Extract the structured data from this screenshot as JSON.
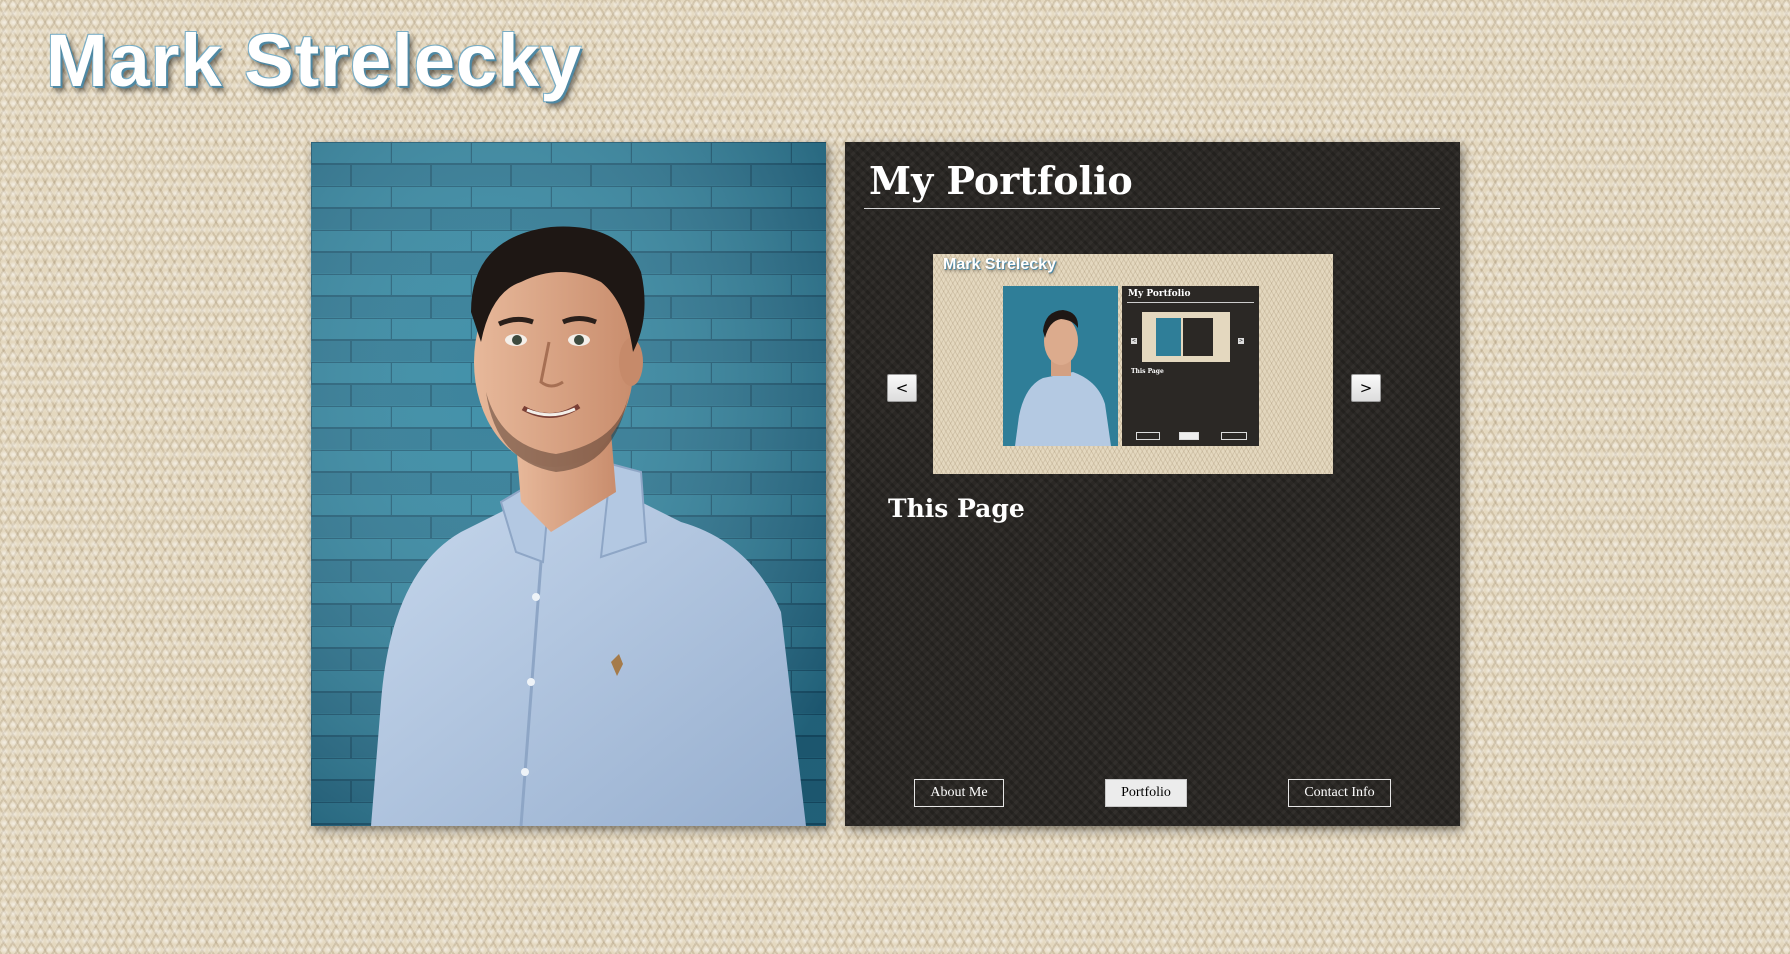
{
  "site": {
    "title": "Mark Strelecky"
  },
  "panel": {
    "heading": "My Portfolio",
    "prev_label": "<",
    "next_label": ">",
    "slide_caption": "This Page"
  },
  "preview": {
    "title": "Mark Strelecky",
    "heading": "My Portfolio",
    "caption": "This Page",
    "prev_label": "<",
    "next_label": ">"
  },
  "nav": {
    "about_label": "About Me",
    "portfolio_label": "Portfolio",
    "contact_label": "Contact Info",
    "active": "Portfolio"
  },
  "colors": {
    "background": "#e4d8bf",
    "panel": "#2b2825",
    "photo_wall": "#2f7e98",
    "shirt": "#b4c9e2",
    "title_outline": "#4e88a3"
  }
}
